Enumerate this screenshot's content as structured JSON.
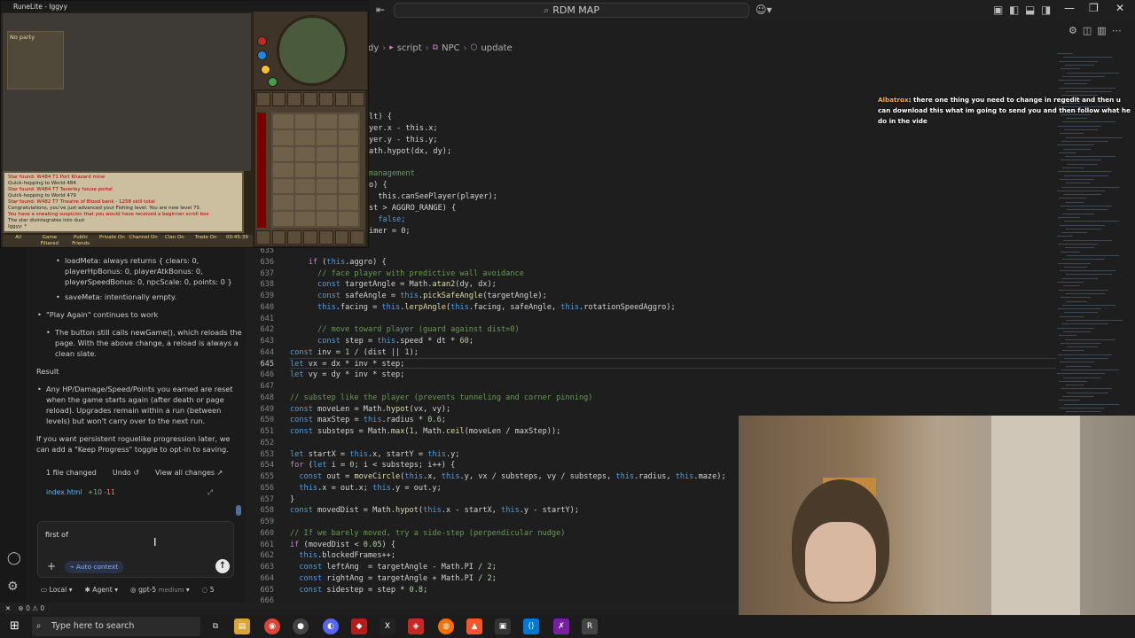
{
  "game": {
    "title": "RuneLite - Iggyy",
    "no_party": "No party",
    "chat_lines": [
      "Star found: W484 T1 Port Khazard mine",
      "Quick-hopping to World 484",
      "Star found: W484 T7 Taverley house portal",
      "Quick-hopping to World 479",
      "Star found: W482 T7 Theatre of Blood bank - 1258 skill total",
      "Congratulations, you've just advanced your Fishing level. You are now level 75.",
      "You have a sneaking suspicion that you would have received a beginner scroll box",
      "The star disintegrates into dust",
      "Iggyy: *"
    ],
    "chat_tabs": [
      "All",
      "Game Filtered",
      "Public Friends",
      "Private On",
      "Channel On",
      "Clan On",
      "Trade On",
      "00:45:39"
    ]
  },
  "titlebar": {
    "command_center": "RDM MAP",
    "icons": [
      "back-icon",
      "copilot-icon",
      "layout-icon"
    ]
  },
  "breadcrumb": [
    "dy",
    "script",
    "NPC",
    "update"
  ],
  "overlay_chat": {
    "name": "Albatrox",
    "text": ": there one thing you need to change in regedit and then u can download this what im going to send you and then follow what he do in the vide"
  },
  "upper_code": [
    "lt) {",
    "yer.x - this.x;",
    "yer.y - this.y;",
    "ath.hypot(dx, dy);",
    "",
    "management",
    "o) {",
    "  this.canSeePlayer(player);",
    "st > AGGRO_RANGE) {",
    "  false;",
    "imer = 0;"
  ],
  "code": [
    {
      "n": "635",
      "t": ""
    },
    {
      "n": "636",
      "t": "    if (this.aggro) {"
    },
    {
      "n": "637",
      "t": "      // face player with predictive wall avoidance"
    },
    {
      "n": "638",
      "t": "      const targetAngle = Math.atan2(dy, dx);"
    },
    {
      "n": "639",
      "t": "      const safeAngle = this.pickSafeAngle(targetAngle);"
    },
    {
      "n": "640",
      "t": "      this.facing = this.lerpAngle(this.facing, safeAngle, this.rotationSpeedAggro);"
    },
    {
      "n": "641",
      "t": ""
    },
    {
      "n": "642",
      "t": "      // move toward player (guard against dist=0)"
    },
    {
      "n": "643",
      "t": "      const step = this.speed * dt * 60;"
    },
    {
      "n": "644",
      "t": "const inv = 1 / (dist || 1);"
    },
    {
      "n": "645",
      "t": "let vx = dx * inv * step;"
    },
    {
      "n": "646",
      "t": "let vy = dy * inv * step;"
    },
    {
      "n": "647",
      "t": ""
    },
    {
      "n": "648",
      "t": "// substep like the player (prevents tunneling and corner pinning)"
    },
    {
      "n": "649",
      "t": "const moveLen = Math.hypot(vx, vy);"
    },
    {
      "n": "650",
      "t": "const maxStep = this.radius * 0.6;"
    },
    {
      "n": "651",
      "t": "const substeps = Math.max(1, Math.ceil(moveLen / maxStep));"
    },
    {
      "n": "652",
      "t": ""
    },
    {
      "n": "653",
      "t": "let startX = this.x, startY = this.y;"
    },
    {
      "n": "654",
      "t": "for (let i = 0; i < substeps; i++) {"
    },
    {
      "n": "655",
      "t": "  const out = moveCircle(this.x, this.y, vx / substeps, vy / substeps, this.radius, this.maze);"
    },
    {
      "n": "656",
      "t": "  this.x = out.x; this.y = out.y;"
    },
    {
      "n": "657",
      "t": "}"
    },
    {
      "n": "658",
      "t": "const movedDist = Math.hypot(this.x - startX, this.y - startY);"
    },
    {
      "n": "659",
      "t": ""
    },
    {
      "n": "660",
      "t": "// If we barely moved, try a side-step (perpendicular nudge)"
    },
    {
      "n": "661",
      "t": "if (movedDist < 0.05) {"
    },
    {
      "n": "662",
      "t": "  this.blockedFrames++;"
    },
    {
      "n": "663",
      "t": "  const leftAng  = targetAngle - Math.PI / 2;"
    },
    {
      "n": "664",
      "t": "  const rightAng = targetAngle + Math.PI / 2;"
    },
    {
      "n": "665",
      "t": "  const sidestep = step * 0.8;"
    },
    {
      "n": "666",
      "t": ""
    }
  ],
  "current_line": "645",
  "sidebar": {
    "meta_lines": [
      "loadMeta: always returns { clears: 0,",
      "playerHpBonus: 0, playerAtkBonus: 0,",
      "playerSpeedBonus: 0, npcScale: 0, points: 0 }"
    ],
    "save_meta": "saveMeta: intentionally empty.",
    "play_again": "\"Play Again\" continues to work",
    "play_again_detail": [
      "The button still calls newGame(), which reloads the",
      "page. With the above change, a reload is always a",
      "clean slate."
    ],
    "result_heading": "Result",
    "result_detail": [
      "Any HP/Damage/Speed/Points you earned are reset",
      "when the game starts again (after death or page",
      "reload). Upgrades remain within a run (between",
      "levels) but won't carry over to the next run."
    ],
    "followup": [
      "If you want persistent roguelike progression later, we",
      "can add a \"Keep Progress\" toggle to opt-in to saving."
    ],
    "files_changed": "1 file changed",
    "undo": "Undo",
    "view_all": "View all changes",
    "file_name": "index.html",
    "added": "+10",
    "removed": "-11",
    "input_value": "first of",
    "auto_context": "Auto context",
    "mode_local": "Local",
    "mode_agent": "Agent",
    "model": "gpt-5",
    "model_effort": "medium",
    "spinner": "5"
  },
  "statusbar": {
    "problems": "0",
    "warnings": "0"
  },
  "taskbar": {
    "search_placeholder": "Type here to search"
  },
  "colors": {
    "editor_bg": "#1e1e1e",
    "accent": "#0078d4",
    "link": "#4fc1ff"
  }
}
